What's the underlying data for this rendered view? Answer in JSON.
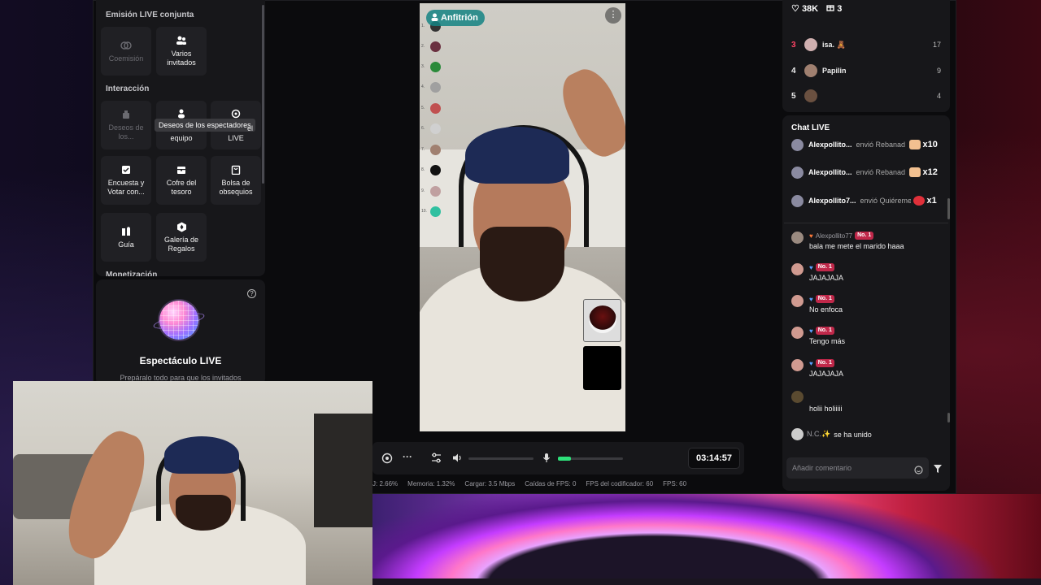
{
  "left_panel": {
    "section_joint": "Emisión LIVE conjunta",
    "joint_tiles": [
      {
        "label": "Coemisión",
        "icon": "co-host-icon",
        "enabled": false
      },
      {
        "label": "Varios invitados",
        "icon": "multi-guest-icon",
        "enabled": true
      }
    ],
    "section_interaction": "Interacción",
    "interaction_tiles": [
      {
        "label": "Deseos de los...",
        "icon": "wishes-icon",
        "enabled": false
      },
      {
        "label": "equipo",
        "icon": "team-icon",
        "enabled": true
      },
      {
        "label": "LIVE",
        "icon": "live-goal-icon",
        "enabled": true
      },
      {
        "label": "Encuesta y Votar con...",
        "icon": "poll-icon",
        "enabled": true
      },
      {
        "label": "Cofre del tesoro",
        "icon": "treasure-chest-icon",
        "enabled": true
      },
      {
        "label": "Bolsa de obsequios",
        "icon": "gift-bag-icon",
        "enabled": true
      },
      {
        "label": "Guía",
        "icon": "guide-icon",
        "enabled": true
      },
      {
        "label": "Galería de Regalos",
        "icon": "gift-gallery-icon",
        "enabled": true
      }
    ],
    "section_monetization": "Monetización",
    "tooltip": "Deseos de los espectadores",
    "tile_team_suffix": "el",
    "show": {
      "title": "Espectáculo LIVE",
      "subtitle": "Prepáralo todo para que los invitados"
    }
  },
  "stream": {
    "host_badge": "Anfitrión",
    "more_icon": "more-options-icon"
  },
  "controls": {
    "timer": "03:14:57",
    "mic_level": 0.2,
    "stats": [
      {
        "label": "J:",
        "value": "2.66%"
      },
      {
        "label": "Memoria:",
        "value": "1.32%"
      },
      {
        "label": "Cargar:",
        "value": "3.5 Mbps"
      },
      {
        "label": "Caídas de FPS:",
        "value": "0"
      },
      {
        "label": "FPS del codificador:",
        "value": "60"
      },
      {
        "label": "FPS:",
        "value": "60"
      }
    ]
  },
  "right_panel": {
    "likes": "38K",
    "gifts": "3",
    "leaderboard": [
      {
        "rank": "3",
        "name": "isa. 🧸",
        "score": "17"
      },
      {
        "rank": "4",
        "name": "Papilin",
        "score": "9"
      },
      {
        "rank": "5",
        "name": "",
        "score": "4"
      }
    ],
    "chat_title": "Chat LIVE",
    "gift_events": [
      {
        "name": "Alexpollito...",
        "action": "envió Rebanad",
        "count": "x10",
        "color": "#f2c090"
      },
      {
        "name": "Alexpollito...",
        "action": "envió Rebanad",
        "count": "x12",
        "color": "#f2c090"
      },
      {
        "name": "Alexpollito7...",
        "action": "envió Quiéreme",
        "count": "x1",
        "color": "#e0303a"
      }
    ],
    "messages": [
      {
        "name": "Alexpollito77",
        "badge": "No. 1",
        "text": "bala me mete el marido haaa"
      },
      {
        "name": "",
        "badge": "No. 1",
        "text": "JAJAJAJA"
      },
      {
        "name": "",
        "badge": "No. 1",
        "text": "No enfoca"
      },
      {
        "name": "",
        "badge": "No. 1",
        "text": "Tengo más"
      },
      {
        "name": "",
        "badge": "No. 1",
        "text": "JAJAJAJA"
      },
      {
        "name": "",
        "badge": "",
        "text": "holii holiiiii"
      }
    ],
    "join": {
      "name": "N.C.✨",
      "text": "se ha unido"
    },
    "comment_placeholder": "Añadir comentario"
  }
}
